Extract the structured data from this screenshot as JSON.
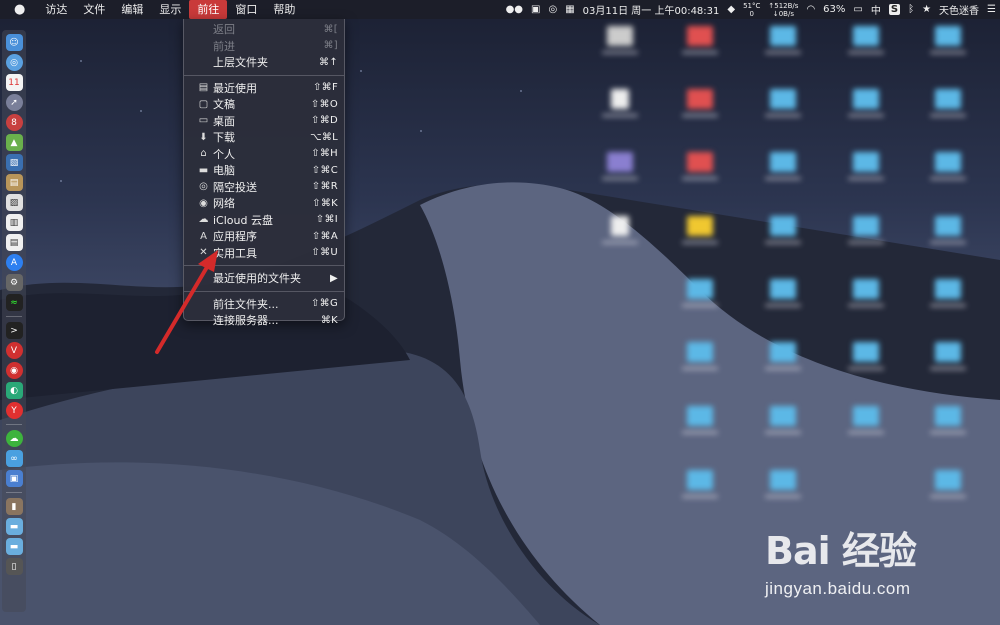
{
  "menubar": {
    "apple": "",
    "items": [
      "访达",
      "文件",
      "编辑",
      "显示",
      "前往",
      "窗口",
      "帮助"
    ],
    "active_index": 4,
    "status": {
      "cpu_temp": "51°C",
      "cpu_val": "0",
      "net_up": "↑512B/s",
      "net_down": "↓0B/s",
      "datetime": "03月11日 周一 上午00:48:31",
      "battery": "63%",
      "input_method": "中",
      "user": "天色迷香"
    }
  },
  "go_menu": {
    "groups": [
      [
        {
          "label": "返回",
          "shortcut": "⌘[",
          "disabled": true,
          "icon": ""
        },
        {
          "label": "前进",
          "shortcut": "⌘]",
          "disabled": true,
          "icon": ""
        },
        {
          "label": "上层文件夹",
          "shortcut": "⌘↑",
          "disabled": false,
          "icon": ""
        }
      ],
      [
        {
          "label": "最近使用",
          "shortcut": "⇧⌘F",
          "icon": "recents-icon"
        },
        {
          "label": "文稿",
          "shortcut": "⇧⌘O",
          "icon": "documents-icon"
        },
        {
          "label": "桌面",
          "shortcut": "⇧⌘D",
          "icon": "desktop-icon"
        },
        {
          "label": "下载",
          "shortcut": "⌥⌘L",
          "icon": "downloads-icon"
        },
        {
          "label": "个人",
          "shortcut": "⇧⌘H",
          "icon": "home-icon"
        },
        {
          "label": "电脑",
          "shortcut": "⇧⌘C",
          "icon": "computer-icon"
        },
        {
          "label": "隔空投送",
          "shortcut": "⇧⌘R",
          "icon": "airdrop-icon"
        },
        {
          "label": "网络",
          "shortcut": "⇧⌘K",
          "icon": "network-icon"
        },
        {
          "label": "iCloud 云盘",
          "shortcut": "⇧⌘I",
          "icon": "icloud-icon"
        },
        {
          "label": "应用程序",
          "shortcut": "⇧⌘A",
          "icon": "applications-icon"
        },
        {
          "label": "实用工具",
          "shortcut": "⇧⌘U",
          "icon": "utilities-icon"
        }
      ],
      [
        {
          "label": "最近使用的文件夹",
          "shortcut": "▶",
          "icon": "",
          "submenu": true
        }
      ],
      [
        {
          "label": "前往文件夹...",
          "shortcut": "⇧⌘G",
          "icon": ""
        },
        {
          "label": "连接服务器...",
          "shortcut": "⌘K",
          "icon": ""
        }
      ]
    ]
  },
  "watermark": {
    "main": "Bai 经验",
    "sub": "jingyan.baidu.com"
  },
  "colors": {
    "active_menu": "#c93a3a",
    "annotation_arrow": "#d42a2a",
    "folder_blue": "#5cb8e6",
    "folder_red": "#e05050",
    "folder_yellow": "#f0c830"
  }
}
